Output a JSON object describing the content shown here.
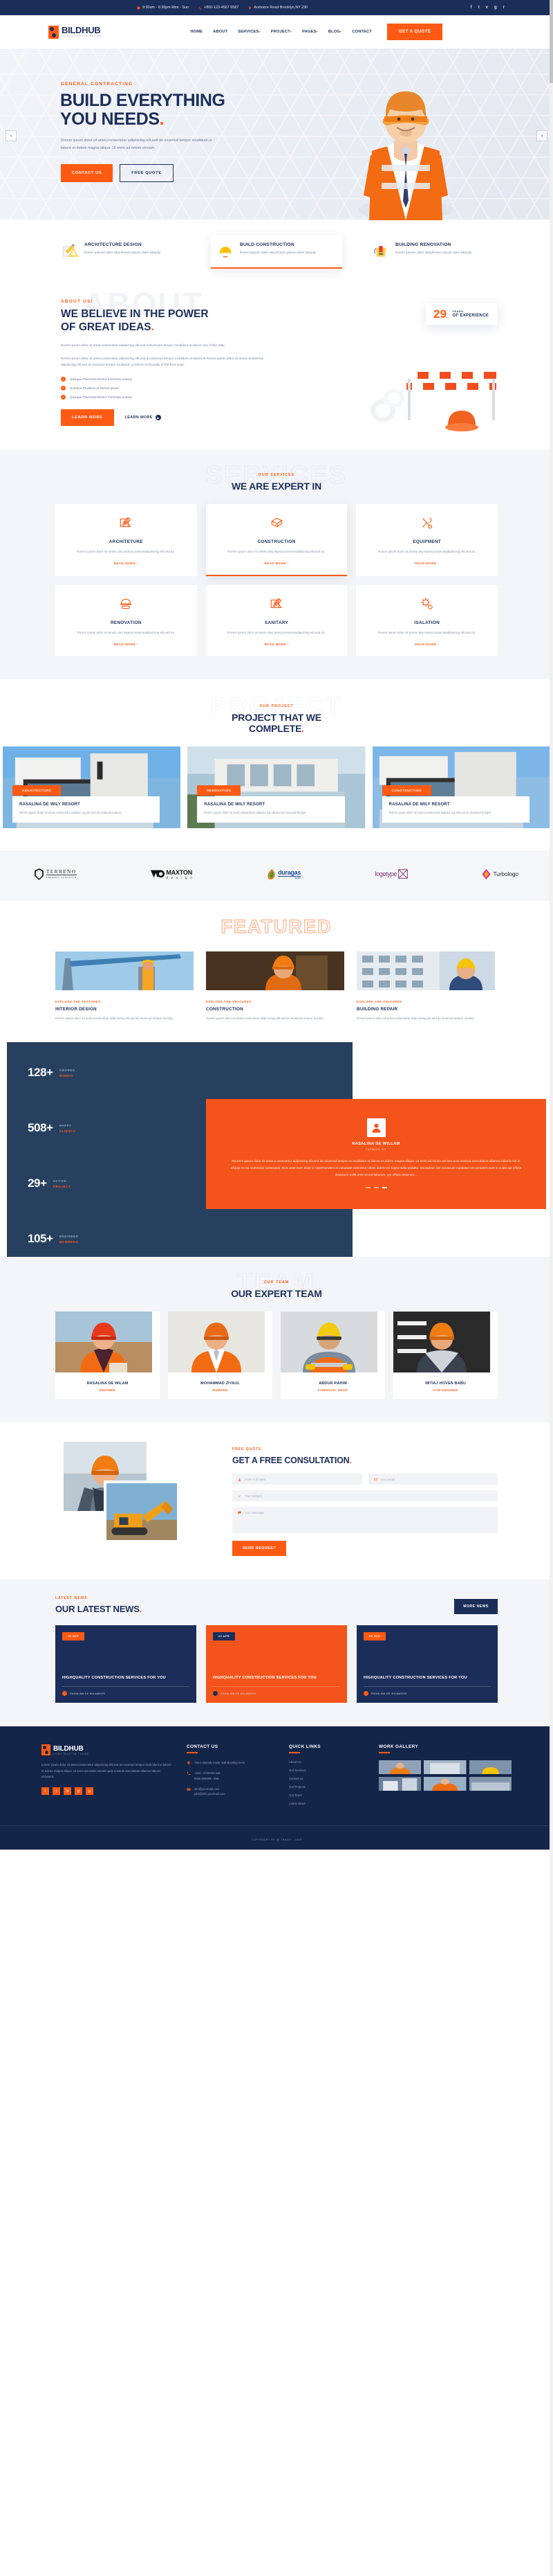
{
  "topbar": {
    "hours": "9:30am - 6:30pm Mon - Sun",
    "phone": "+800-123-4567 6587",
    "address": "Anmoore Road Brooklyn,NY 230",
    "social": [
      "f",
      "t",
      "v",
      "g",
      "r"
    ]
  },
  "brand": {
    "name": "BILDHUB",
    "sub": "CONSTRUCTIN THEME"
  },
  "nav": {
    "items": [
      {
        "label": "HOME",
        "caret": false
      },
      {
        "label": "ABOUT",
        "caret": false
      },
      {
        "label": "SERVICES",
        "caret": true
      },
      {
        "label": "PROJECT",
        "caret": true
      },
      {
        "label": "PAGES",
        "caret": true
      },
      {
        "label": "BLOG",
        "caret": true
      },
      {
        "label": "CONTACT",
        "caret": false
      }
    ],
    "cta": "GET A QUOTE"
  },
  "hero": {
    "eyebrow": "GENERAL CONTRACTING",
    "title_1": "BUILD EVERYTHING",
    "title_2": "YOU NEEDS",
    "dot": ".",
    "paragraph": "Rorem ipsum dolor sit amet,consectetur adipisicing elit,sed do eiusmod tempor incididunt ut labore et dolore magna aliqua. Ut enim ad minim veniam.",
    "btn_primary": "CONTACT US",
    "btn_secondary": "FREE QUOTE",
    "arrow_prev": "‹",
    "arrow_next": "›"
  },
  "strip": {
    "cards": [
      {
        "icon": "blueprint-icon",
        "title": "ARCHITECTURE DESIGN",
        "text": "Rorem ipsoum doler sitey.Rorem psoum doler siteyoly.",
        "active": false
      },
      {
        "icon": "helmet-icon",
        "title": "BUILD CONSTRUCTION",
        "text": "Rorem ipsoum doler sitey.Rorem psoum doler siteyoly.",
        "active": true
      },
      {
        "icon": "paint-bucket-icon",
        "title": "BUILDING RENOVATION",
        "text": "Rorem ipsoum doler sitey.Rorem psoum doler siteyoly.",
        "active": false
      }
    ]
  },
  "about": {
    "ghost": "ABOUT",
    "eyebrow": "ABOUT US!",
    "title_1": "WE BELIEVE IN THE POWER",
    "title_2": "OF GREAT IDEAS",
    "dot": ".",
    "p1": "Rorem ipsum dolor sit amet,consectetur adipisicing elit,sed dok!yeiusm tempor incididunt ut labore etry of the siely.",
    "p2": "Rorem ipsum dolor sit amet,consectetur adipisicing elit,sed do eiusmod tempor incididunt ut labore et Rorem ipsum dolor sit amet,consectetur adipisicing elit,sed do eiusmod tempor incididunt ut labore et Royality of the best sede..",
    "ticks": [
      "Quisque Placereat Mnetur Fermnatu nussey",
      "Noterjon PiLabore ar Rerom ipsum",
      "Quisque Placereat Mnetur Fermnatu nussey"
    ],
    "btn": "LEARN MORE",
    "link": "LEARN MORE",
    "exp_number": "29",
    "exp_dot": ".",
    "exp_label_1": "YEARS",
    "exp_label_2": "OF EXPERIENCE"
  },
  "services": {
    "ghost": "SERVICES",
    "eyebrow": "OUR SERVICES",
    "title": "WE ARE EXPERT IN",
    "read_more": "READ MORE",
    "items": [
      {
        "icon": "architecture-icon",
        "title": "ARCHITETURE",
        "text": "Rorem ipsum dolor sit ameto dey teyeryconsecteadipisicing elit,sed do.",
        "active": false
      },
      {
        "icon": "beam-icon",
        "title": "CONSTRUCTION",
        "text": "Rorem ipsum dolor sit ameto dey teyeryconsecteadipisicing elit,sed do.",
        "active": true
      },
      {
        "icon": "tools-icon",
        "title": "EQUIPMENT",
        "text": "Rorem ipsum dolor sit ameto dey teyeryconsecteadipisicing elit,sed do.",
        "active": false
      },
      {
        "icon": "helmet-goggles-icon",
        "title": "RENOVATION",
        "text": "Rorem ipsum dolor sit ameto dey teyeryconsecteadipisicing elit,sed do.",
        "active": false
      },
      {
        "icon": "architecture-icon",
        "title": "SANITARY",
        "text": "Rorem ipsum dolor sit ameto dey teyeryconsecteadipisicing elit,sed do.",
        "active": false
      },
      {
        "icon": "gear-icon",
        "title": "ISALATION",
        "text": "Rorem ipsum dolor sit ameto dey teyeryconsecteadipisicing elit,sed do.",
        "active": false
      }
    ]
  },
  "projects": {
    "ghost": "PROJECT",
    "eyebrow": "OUR PROJECT",
    "title_1": "PROJECT THAT WE",
    "title_2": "COMPLETE",
    "dot": ".",
    "items": [
      {
        "tag": "ARCHITECTURE",
        "title": "RASALINA DE WILY RESORT",
        "text": "Rorem ipsum dolor sit amet,consectetur adipisic ing elit,sed do eiusmod tempor."
      },
      {
        "tag": "RENOVATION",
        "title": "RASALINA DE WILY RESORT",
        "text": "Rorem ipsum dolor sit amet,consectetur adipisic ing elit,sed do eiusmod tempor."
      },
      {
        "tag": "CONSTRUCTION",
        "title": "RASALINA DE WILY RESORT",
        "text": "Rorem ipsum dolor sit amet,consectetur adipisic ing elit,sed do eiusmod tempor."
      }
    ]
  },
  "brands": [
    {
      "name": "TERRENO",
      "sub": "CHIANTI CLASSICO"
    },
    {
      "name": "MAXTON",
      "sub": "d e s i g n"
    },
    {
      "name": "duragas",
      "sub": "ductile"
    },
    {
      "name": "logotype",
      "sub": ""
    },
    {
      "name": "Turbologo",
      "sub": ""
    }
  ],
  "featured": {
    "ghost": "FEATURED",
    "items": [
      {
        "eyebrow": "EXPLORE THE FEATURES",
        "title": "INTERIOR DESIGN",
        "text": "Rorem ipsum dolor sit amet,consectetur adip isicing elit,sed do eiusmod tempor incutey."
      },
      {
        "eyebrow": "EXPLORE THE FEATURES",
        "title": "CONSTRUCTION",
        "text": "Rorem ipsum dolor sit amet,consectetur adip isicing elit,sed do eiusmod tempor incutey."
      },
      {
        "eyebrow": "EXPLORE THE FEATURES",
        "title": "BUILDING REPAIR",
        "text": "Rorem ipsum dolor sit amet,consectetur adip isicing elit,sed do eiusmod tempor incutey."
      }
    ]
  },
  "stats": {
    "items": [
      {
        "number": "128+",
        "label_1": "AWARDS",
        "label_2": "WINNIG"
      },
      {
        "number": "508+",
        "label_1": "HAPPY",
        "label_2": "CLIENTS"
      },
      {
        "number": "29+",
        "label_1": "ACTIVE",
        "label_2": "PROJECT"
      },
      {
        "number": "105+",
        "label_1": "ENGINEER",
        "label_2": "MEMBERS"
      }
    ],
    "testimonial": {
      "name": "RASALINA DE WILLAM",
      "role": "FARMICE CO",
      "text": "Reorem ipsum dolor sit amet,c onsectetur adipisicing elit,sed do eiusmod tempor ex incididunt ut labore et dolore magna aliqua. Ut enim ad minim veniam,quis nostrud exercitation ullamco laboris nisi ut aliquip ex ea commodo consequat. Duis aute irure dolor in reprehenderit in voluptate velit esse cillum dolore eu fugiat nulla pariatur. Excepteur sint occaecat cupidatat non proident,sunt in culpa qui officia deserunt mollit anim id est laborum. qui officia deserunt..."
    }
  },
  "team": {
    "ghost": "TEAM",
    "eyebrow": "OUR TEAM",
    "title": "OUR EXPERT TEAM",
    "members": [
      {
        "name": "RASALINA DE WILAM",
        "role": "ENGINER"
      },
      {
        "name": "MOHAMMAD ZIYAUL",
        "role": "WORKER"
      },
      {
        "name": "ABDUR RAHIM",
        "role": "FINENCIAL HEAD"
      },
      {
        "name": "IMTIAJ HOVEN BABU",
        "role": "SITE ENGINER"
      }
    ]
  },
  "consult": {
    "eyebrow": "FREE QUOTE",
    "title_1": "GET A FREE CONSULTATION",
    "dot": ".",
    "field_name": "Enter Full name",
    "field_email": "Your email",
    "field_subject": "Your Subject",
    "field_message": "Your Message",
    "submit": "SEND REQUEST"
  },
  "news": {
    "eyebrow": "LATEST NEWS",
    "title_1": "OUR LATEST NEWS",
    "dot": ".",
    "more": "MORE NEWS",
    "items": [
      {
        "date": "15 SEP",
        "title": "HIGHQUALITY CONSTRUCTION SERVICES FOR YOU",
        "text": "Rorem ipsum consecteturr adipisicin opey eiusmod.Rorem consecteturr Rorem ipsumr adipisicin opey.",
        "meta": "RASALINA DE WILAMSON",
        "theme": "dark"
      },
      {
        "date": "22 APR",
        "title": "HIGHQUALITY CONSTRUCTION SERVICES FOR YOU",
        "text": "Rorem ipsum consecteturr adipisicin opey eiusmod.Rorem consecteturr Rorem ipsumr adipisicin opey.",
        "meta": "RASALINA DE WILAMSON",
        "theme": "orange"
      },
      {
        "date": "09 JUN",
        "title": "HIGHQUALITY CONSTRUCTION SERVICES FOR YOU",
        "text": "Rorem ipsum consecteturr adipisicin opey eiusmod.Rorem consecteturr Rorem ipsumr adipisicin opey.",
        "meta": "RASALINA DE WILAMSON",
        "theme": "dark"
      }
    ]
  },
  "footer": {
    "about_text": "Lorem ipsum dolor sit amet,consectetur adipisicing elit,sed do eiusmod tempor incid idunt ut labore et dolore magna aliqua. Ut enim ad minim veniam,quis nostrud exercitation ullamco laboris nisiyepnt.",
    "social": [
      "f",
      "t",
      "in",
      "g",
      "p"
    ],
    "contact_title": "CONTACT US",
    "contact_address": "784 A Normdy lower mall Brooklyn,NY1",
    "contact_phone_1": "+010 - 5738765 046",
    "contact_phone_2": "0025 936589 - 986",
    "contact_email_1": "info@yourmail.com",
    "contact_email_2": "jobs@info.yourmail.com",
    "links_title": "QUICK LINKS",
    "links": [
      "About Us",
      "Our Services",
      "Contact us",
      "Our Projects",
      "Our Team",
      "Latest News"
    ],
    "gallery_title": "WORK GALLERY",
    "copyright": "COPYRIGHT BY @ TRACK - 2020"
  }
}
